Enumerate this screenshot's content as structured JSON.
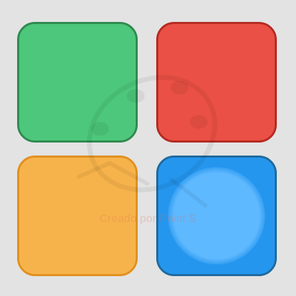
{
  "colors": {
    "background": "#e3e3e3",
    "green": {
      "fill": "#4dc77b",
      "border": "#2f8a50"
    },
    "red": {
      "fill": "#ea5045",
      "border": "#b52a22"
    },
    "orange": {
      "fill": "#f7b34b",
      "border": "#e0901f"
    },
    "blue": {
      "fill": "#2596ee",
      "border": "#1f6a9e",
      "glow": "#5fb9ff"
    },
    "watermark": "rgba(0,0,0,0.06)",
    "watermark_text": "rgba(220,110,90,0.28)"
  },
  "tiles": [
    {
      "name": "green-tile",
      "color": "green",
      "state": "idle"
    },
    {
      "name": "red-tile",
      "color": "red",
      "state": "idle"
    },
    {
      "name": "orange-tile",
      "color": "orange",
      "state": "idle"
    },
    {
      "name": "blue-tile",
      "color": "blue",
      "state": "highlighted"
    }
  ],
  "watermark": {
    "text": "Creado por Point S",
    "icon": "paint-palette-icon"
  }
}
